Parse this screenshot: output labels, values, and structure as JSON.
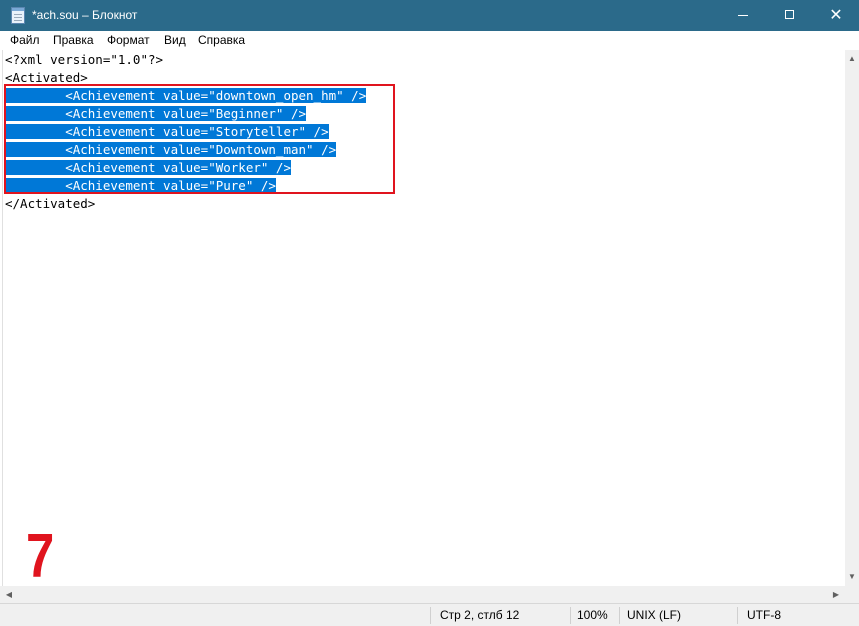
{
  "window": {
    "title": "*ach.sou – Блокнот",
    "minimize_icon": "minimize-icon",
    "maximize_icon": "maximize-icon",
    "close_glyph": "✕"
  },
  "menu": {
    "items": [
      "Файл",
      "Правка",
      "Формат",
      "Вид",
      "Справка"
    ]
  },
  "editor": {
    "lines": [
      "<?xml version=\"1.0\"?>",
      "<Activated>",
      "\t<Achievement value=\"downtown_open_hm\" />",
      "\t<Achievement value=\"Beginner\" />",
      "\t<Achievement value=\"Storyteller\" />",
      "\t<Achievement value=\"Downtown_man\" />",
      "\t<Achievement value=\"Worker\" />",
      "\t<Achievement value=\"Pure\" />",
      "</Activated>"
    ],
    "selected_lines": [
      3,
      4,
      5,
      6,
      7,
      8
    ],
    "selection_color": "#0078d7",
    "highlight_box_color": "#e0141e"
  },
  "annotation": {
    "step_number": "7"
  },
  "statusbar": {
    "position": "Стр 2, стлб 12",
    "zoom": "100%",
    "line_endings": "UNIX (LF)",
    "encoding": "UTF-8"
  }
}
